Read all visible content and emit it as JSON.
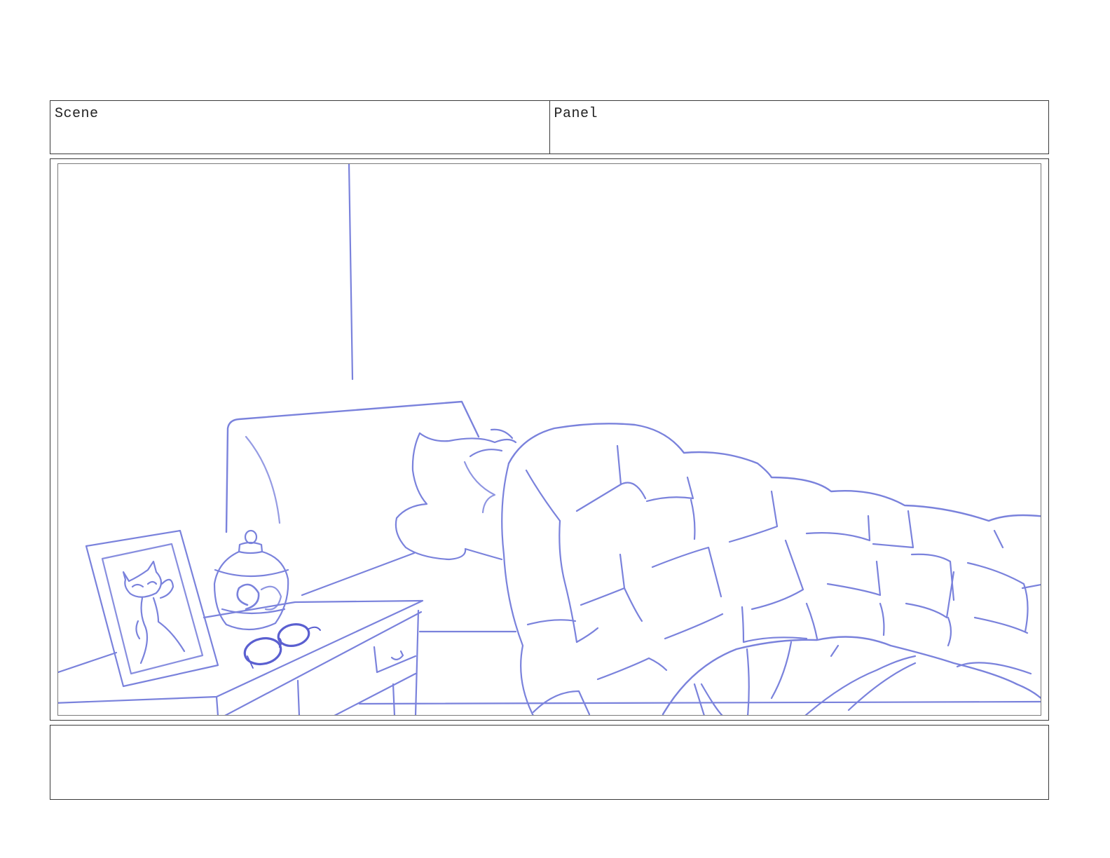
{
  "header": {
    "scene_label": "Scene",
    "panel_label": "Panel"
  },
  "sketch": {
    "line_color": "#7a82dc",
    "line_color_dark": "#5a5fd0"
  },
  "notes": {
    "text": ""
  }
}
